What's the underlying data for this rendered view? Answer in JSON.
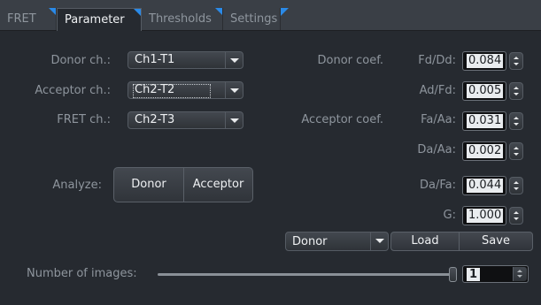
{
  "tabs": [
    {
      "label": "FRET",
      "active": false
    },
    {
      "label": "Parameter",
      "active": true
    },
    {
      "label": "Thresholds",
      "active": false
    },
    {
      "label": "Settings",
      "active": false
    }
  ],
  "channels": {
    "donor_label": "Donor ch.:",
    "donor_value": "Ch1-T1",
    "acceptor_label": "Acceptor ch.:",
    "acceptor_value": "Ch2-T2",
    "fret_label": "FRET ch.:",
    "fret_value": "Ch2-T3"
  },
  "analyze": {
    "label": "Analyze:",
    "donor_button": "Donor",
    "acceptor_button": "Acceptor"
  },
  "coefficients": {
    "donor_coef_label": "Donor coef.",
    "acceptor_coef_label": "Acceptor coef.",
    "items": [
      {
        "label": "Fd/Dd:",
        "value": "0.084"
      },
      {
        "label": "Ad/Fd:",
        "value": "0.005"
      },
      {
        "label": "Fa/Aa:",
        "value": "0.031"
      },
      {
        "label": "Da/Aa:",
        "value": "0.002"
      },
      {
        "label": "Da/Fa:",
        "value": "0.044"
      },
      {
        "label": "G:",
        "value": "1.000"
      }
    ]
  },
  "preset": {
    "selected": "Donor",
    "load_button": "Load",
    "save_button": "Save"
  },
  "images": {
    "label": "Number of images:",
    "value": "1"
  },
  "colors": {
    "accent": "#2a8ae8",
    "background": "#262a30"
  }
}
